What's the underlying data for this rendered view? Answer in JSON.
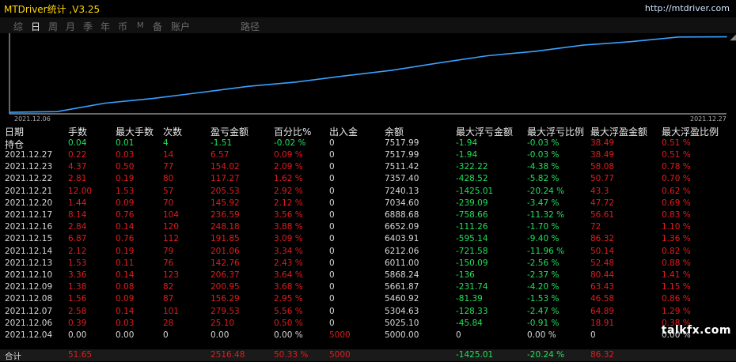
{
  "window": {
    "title": "MTDriver统计 ,V3.25",
    "site": "http://mtdriver.com"
  },
  "tabs": [
    {
      "label": "综",
      "active": false
    },
    {
      "label": "日",
      "active": true
    },
    {
      "label": "周",
      "active": false
    },
    {
      "label": "月",
      "active": false
    },
    {
      "label": "季",
      "active": false
    },
    {
      "label": "年",
      "active": false
    },
    {
      "label": "币",
      "active": false
    },
    {
      "label": "M",
      "active": false
    },
    {
      "label": "备",
      "active": false
    },
    {
      "label": "账户",
      "active": false
    },
    {
      "label": "路径",
      "active": false
    }
  ],
  "chart_data": {
    "type": "line",
    "x_start_label": "2021.12.06",
    "x_end_label": "2021.12.27",
    "line_color": "#3aa0ff",
    "x": [
      "2021.12.04",
      "2021.12.06",
      "2021.12.07",
      "2021.12.08",
      "2021.12.09",
      "2021.12.10",
      "2021.12.13",
      "2021.12.14",
      "2021.12.15",
      "2021.12.16",
      "2021.12.17",
      "2021.12.20",
      "2021.12.21",
      "2021.12.22",
      "2021.12.23",
      "2021.12.27"
    ],
    "values": [
      5000.0,
      5025.1,
      5304.63,
      5460.92,
      5661.87,
      5868.24,
      6011.0,
      6212.06,
      6403.91,
      6652.09,
      6888.68,
      7034.6,
      7240.13,
      7357.4,
      7511.42,
      7517.99
    ]
  },
  "table": {
    "headers": [
      "日期",
      "手数",
      "最大手数",
      "次数",
      "盈亏金额",
      "百分比%",
      "出入金",
      "余额",
      "最大浮亏金额",
      "最大浮亏比例",
      "最大浮盈金额",
      "最大浮盈比例"
    ],
    "hold": {
      "label": "持仓",
      "cells": [
        "0.04",
        "0.01",
        "4",
        "-1.51",
        "-0.02 %",
        "0",
        "7517.99",
        "-1.94",
        "-0.03 %",
        "38.49",
        "0.51 %"
      ]
    },
    "rows": [
      {
        "date": "2021.12.27",
        "cells": [
          "0.22",
          "0.03",
          "14",
          "6.57",
          "0.09 %",
          "0",
          "7517.99",
          "-1.94",
          "-0.03 %",
          "38.49",
          "0.51 %"
        ]
      },
      {
        "date": "2021.12.23",
        "cells": [
          "4.37",
          "0.50",
          "77",
          "154.02",
          "2.09 %",
          "0",
          "7511.42",
          "-322.22",
          "-4.38 %",
          "58.08",
          "0.78 %"
        ]
      },
      {
        "date": "2021.12.22",
        "cells": [
          "2.81",
          "0.19",
          "80",
          "117.27",
          "1.62 %",
          "0",
          "7357.40",
          "-428.52",
          "-5.82 %",
          "50.77",
          "0.70 %"
        ]
      },
      {
        "date": "2021.12.21",
        "cells": [
          "12.00",
          "1.53",
          "57",
          "205.53",
          "2.92 %",
          "0",
          "7240.13",
          "-1425.01",
          "-20.24 %",
          "43.3",
          "0.62 %"
        ]
      },
      {
        "date": "2021.12.20",
        "cells": [
          "1.44",
          "0.09",
          "70",
          "145.92",
          "2.12 %",
          "0",
          "7034.60",
          "-239.09",
          "-3.47 %",
          "47.72",
          "0.69 %"
        ]
      },
      {
        "date": "2021.12.17",
        "cells": [
          "8.14",
          "0.76",
          "104",
          "236.59",
          "3.56 %",
          "0",
          "6888.68",
          "-758.66",
          "-11.32 %",
          "56.61",
          "0.83 %"
        ]
      },
      {
        "date": "2021.12.16",
        "cells": [
          "2.84",
          "0.14",
          "120",
          "248.18",
          "3.88 %",
          "0",
          "6652.09",
          "-111.26",
          "-1.70 %",
          "72",
          "1.10 %"
        ]
      },
      {
        "date": "2021.12.15",
        "cells": [
          "6.87",
          "0.76",
          "112",
          "191.85",
          "3.09 %",
          "0",
          "6403.91",
          "-595.14",
          "-9.40 %",
          "86.32",
          "1.36 %"
        ]
      },
      {
        "date": "2021.12.14",
        "cells": [
          "2.12",
          "0.19",
          "79",
          "201.06",
          "3.34 %",
          "0",
          "6212.06",
          "-721.58",
          "-11.96 %",
          "50.14",
          "0.82 %"
        ]
      },
      {
        "date": "2021.12.13",
        "cells": [
          "1.53",
          "0.11",
          "76",
          "142.76",
          "2.43 %",
          "0",
          "6011.00",
          "-150.09",
          "-2.56 %",
          "52.48",
          "0.88 %"
        ]
      },
      {
        "date": "2021.12.10",
        "cells": [
          "3.36",
          "0.14",
          "123",
          "206.37",
          "3.64 %",
          "0",
          "5868.24",
          "-136",
          "-2.37 %",
          "80.44",
          "1.41 %"
        ]
      },
      {
        "date": "2021.12.09",
        "cells": [
          "1.38",
          "0.08",
          "82",
          "200.95",
          "3.68 %",
          "0",
          "5661.87",
          "-231.74",
          "-4.20 %",
          "63.43",
          "1.15 %"
        ]
      },
      {
        "date": "2021.12.08",
        "cells": [
          "1.56",
          "0.09",
          "87",
          "156.29",
          "2.95 %",
          "0",
          "5460.92",
          "-81.39",
          "-1.53 %",
          "46.58",
          "0.86 %"
        ]
      },
      {
        "date": "2021.12.07",
        "cells": [
          "2.58",
          "0.14",
          "101",
          "279.53",
          "5.56 %",
          "0",
          "5304.63",
          "-128.33",
          "-2.47 %",
          "64.89",
          "1.29 %"
        ]
      },
      {
        "date": "2021.12.06",
        "cells": [
          "0.39",
          "0.03",
          "28",
          "25.10",
          "0.50 %",
          "0",
          "5025.10",
          "-45.84",
          "-0.91 %",
          "18.91",
          "0.38 %"
        ]
      },
      {
        "date": "2021.12.04",
        "cells": [
          "0.00",
          "0.00",
          "0",
          "0.00",
          "0.00 %",
          "5000",
          "5000.00",
          "0",
          "0.00 %",
          "0",
          "0.00 %"
        ]
      }
    ],
    "total": {
      "label": "合计",
      "cells": [
        "51.65",
        "",
        "",
        "2516.48",
        "50.33 %",
        "5000",
        "",
        "-1425.01",
        "-20.24 %",
        "86.32",
        ""
      ]
    }
  },
  "watermark": "talkfx.com",
  "colors": {
    "positive": "#e11c1c",
    "negative": "#21e05a",
    "neutral": "#d8d8d8",
    "title": "#ffd700"
  }
}
